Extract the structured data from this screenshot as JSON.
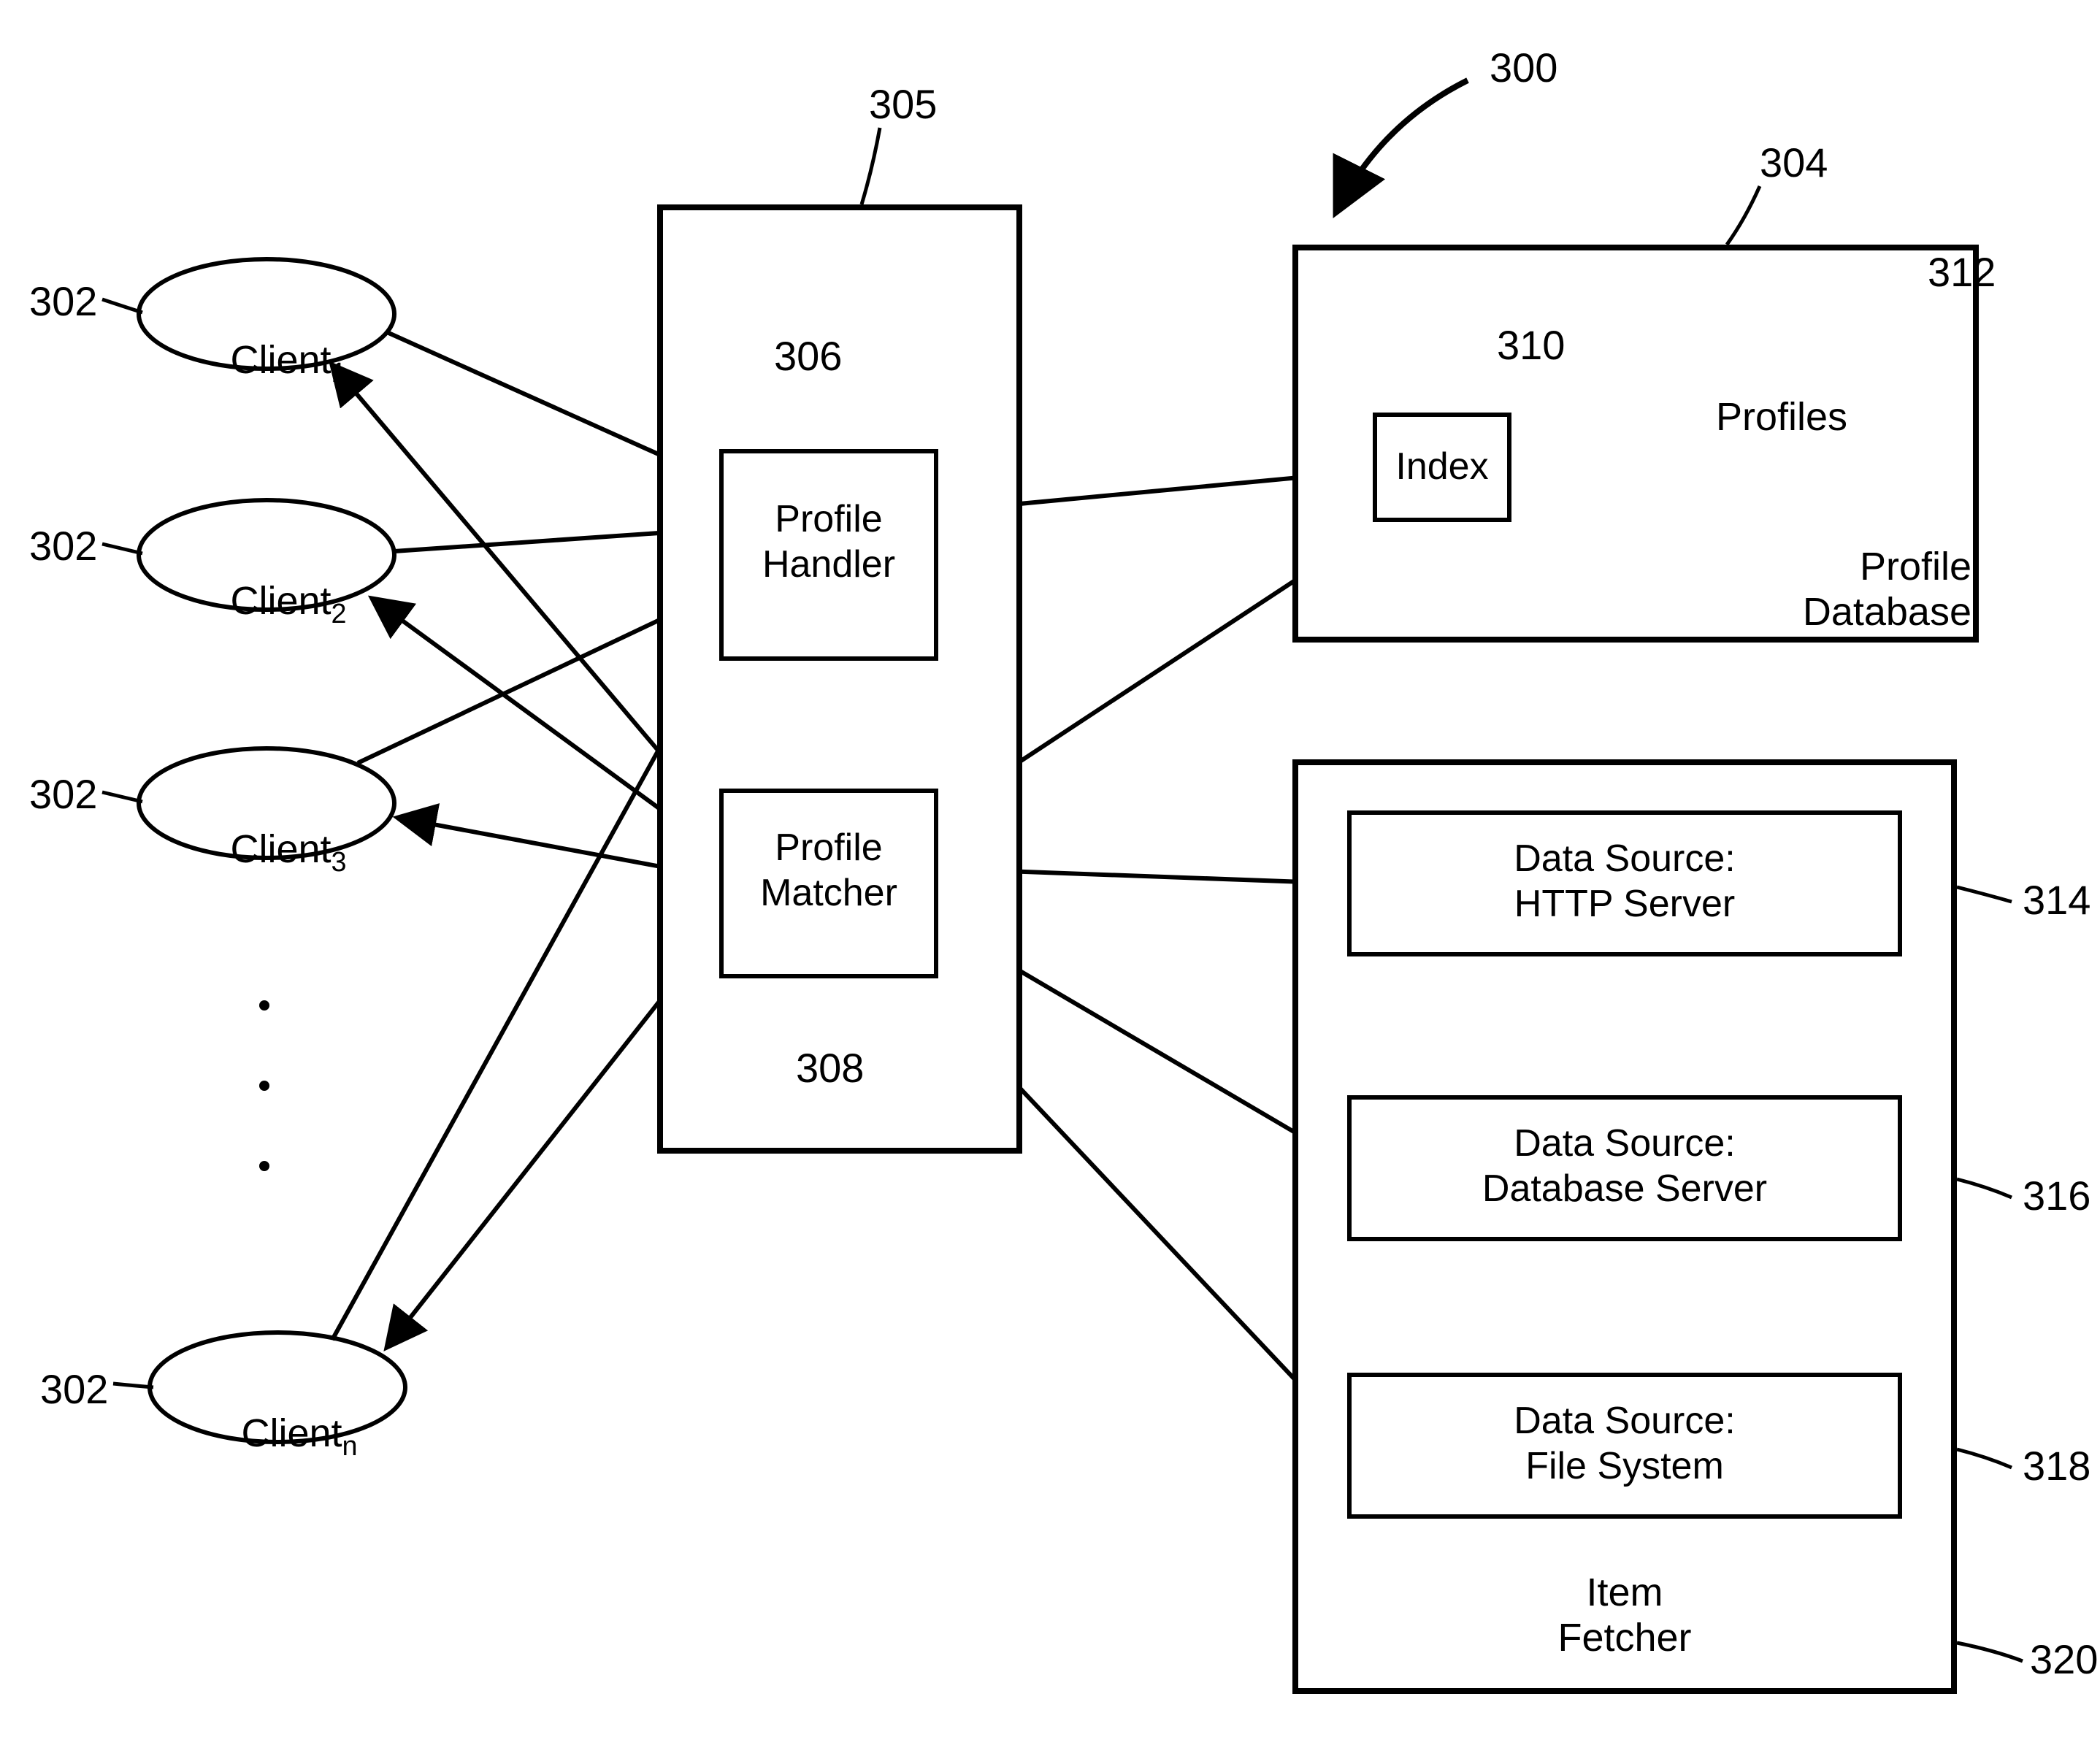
{
  "refs": {
    "overall": "300",
    "client": "302",
    "profileDb": "304",
    "procBox": "305",
    "handler": "306",
    "matcher": "308",
    "indexBox": "310",
    "profiles": "312",
    "dsHttp": "314",
    "dsDb": "316",
    "dsFs": "318",
    "fetcher": "320"
  },
  "clients": {
    "c1": {
      "name": "Client",
      "sub": "1"
    },
    "c2": {
      "name": "Client",
      "sub": "2"
    },
    "c3": {
      "name": "Client",
      "sub": "3"
    },
    "cn": {
      "name": "Client",
      "sub": "n"
    }
  },
  "handler": {
    "l1": "Profile",
    "l2": "Handler"
  },
  "matcher": {
    "l1": "Profile",
    "l2": "Matcher"
  },
  "indexBox": {
    "label": "Index"
  },
  "profilesCyl": {
    "label": "Profiles"
  },
  "profileDb": {
    "l1": "Profile",
    "l2": "Database"
  },
  "ds": {
    "http": {
      "l1": "Data Source:",
      "l2": "HTTP Server"
    },
    "db": {
      "l1": "Data Source:",
      "l2": "Database Server"
    },
    "fs": {
      "l1": "Data Source:",
      "l2": "File System"
    }
  },
  "fetcher": {
    "l1": "Item",
    "l2": "Fetcher"
  }
}
